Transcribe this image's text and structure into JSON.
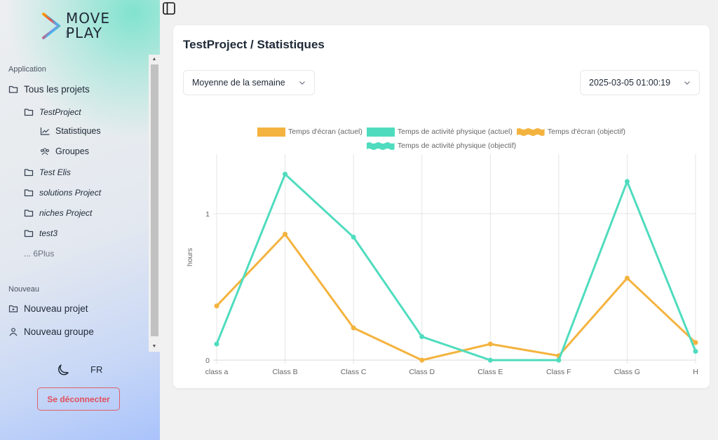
{
  "brand": {
    "line1": "MOVE",
    "small": "THEN",
    "line2": "PLAY"
  },
  "sidebar": {
    "application_label": "Application",
    "all_projects": "Tous les projets",
    "projects": [
      {
        "label": "TestProject",
        "children": [
          {
            "label": "Statistiques",
            "icon": "chart-line-icon"
          },
          {
            "label": "Groupes",
            "icon": "users-icon"
          }
        ]
      },
      {
        "label": "Test Elis"
      },
      {
        "label": "solutions Project"
      },
      {
        "label": "niches Project"
      },
      {
        "label": "test3"
      }
    ],
    "more_label": "... 6Plus",
    "new_label": "Nouveau",
    "new_items": [
      {
        "label": "Nouveau projet",
        "icon": "folder-plus-icon"
      },
      {
        "label": "Nouveau groupe",
        "icon": "user-icon"
      }
    ],
    "language": "FR",
    "logout": "Se déconnecter"
  },
  "main": {
    "title": "TestProject / Statistiques",
    "period_select": "Moyenne de la semaine",
    "date_select": "2025-03-05 01:00:19"
  },
  "colors": {
    "screen": "#f4b33e",
    "activity": "#4fdcbe",
    "logout": "#e0505c"
  },
  "chart_data": {
    "type": "line",
    "title": "",
    "xlabel": "",
    "ylabel": "hours",
    "categories": [
      "class a",
      "Class B",
      "Class C",
      "Class D",
      "Class E",
      "Class F",
      "Class G",
      "H"
    ],
    "ylim": [
      0,
      1.3
    ],
    "yticks": [
      0,
      1
    ],
    "grid": true,
    "legend_position": "top",
    "legend": [
      "Temps d'écran (actuel)",
      "Temps de activité physique (actuel)",
      "Temps d'écran (objectif)",
      "Temps de activité physique (objectif)"
    ],
    "series": [
      {
        "name": "Temps d'écran (actuel)",
        "color": "#f4b33e",
        "values": [
          0.37,
          0.86,
          0.22,
          0.0,
          0.11,
          0.03,
          0.56,
          0.12
        ]
      },
      {
        "name": "Temps de activité physique (actuel)",
        "color": "#4fdcbe",
        "values": [
          0.11,
          1.27,
          0.84,
          0.16,
          0.0,
          0.0,
          1.22,
          0.06
        ]
      },
      {
        "name": "Temps d'écran (objectif)",
        "color": "#f4b33e",
        "values": []
      },
      {
        "name": "Temps de activité physique (objectif)",
        "color": "#4fdcbe",
        "values": []
      }
    ]
  }
}
